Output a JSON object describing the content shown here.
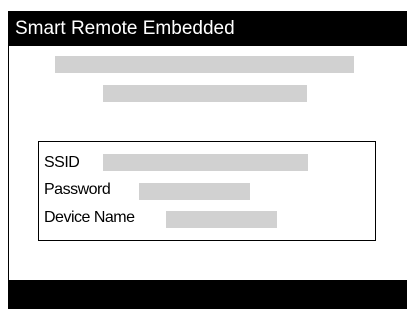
{
  "header": {
    "title": "Smart Remote Embedded"
  },
  "network_info": {
    "ssid_label": "SSID",
    "password_label": "Password",
    "device_name_label": "Device Name"
  }
}
